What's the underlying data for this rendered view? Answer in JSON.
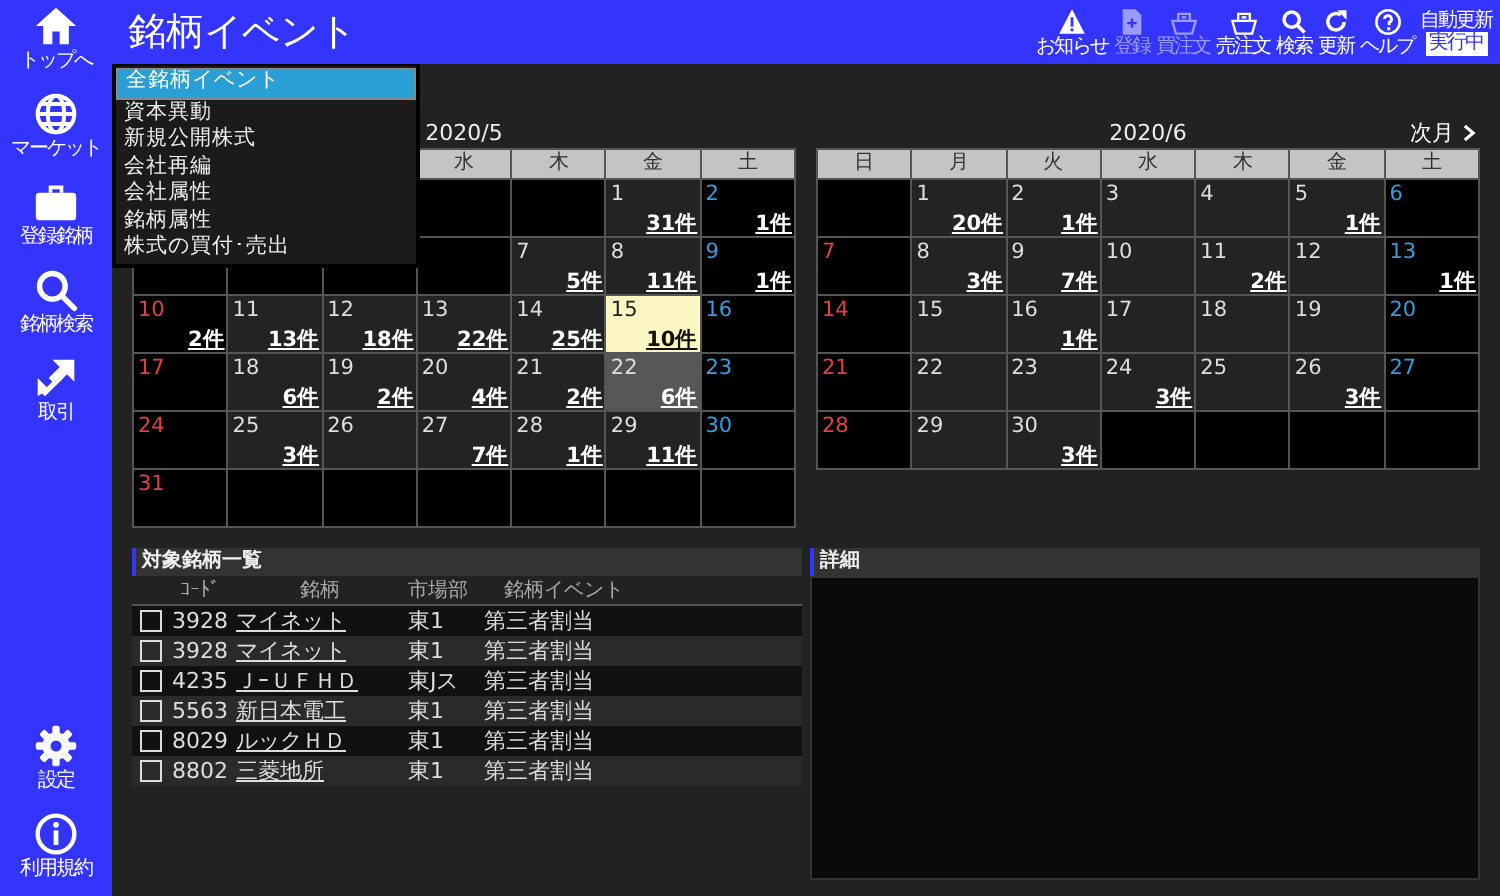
{
  "sidebar": {
    "top_items": [
      {
        "label": "トップへ"
      },
      {
        "label": "マーケット"
      },
      {
        "label": "登録銘柄"
      },
      {
        "label": "銘柄検索"
      },
      {
        "label": "取引"
      }
    ],
    "bottom_items": [
      {
        "label": "設定"
      },
      {
        "label": "利用規約"
      }
    ]
  },
  "header": {
    "title": "銘柄イベント",
    "toolbar": [
      {
        "label": "お知らせ",
        "disabled": false
      },
      {
        "label": "登録",
        "disabled": true
      },
      {
        "label": "買注文",
        "disabled": true
      },
      {
        "label": "売注文",
        "disabled": false
      },
      {
        "label": "検索",
        "disabled": false
      },
      {
        "label": "更新",
        "disabled": false
      },
      {
        "label": "ヘルプ",
        "disabled": false
      }
    ],
    "auto_update": {
      "label": "自動更新",
      "status": "実行中"
    }
  },
  "event_menu": [
    {
      "label": "全銘柄イベント",
      "selected": true
    },
    {
      "label": "資本異動",
      "selected": false
    },
    {
      "label": "新規公開株式",
      "selected": false
    },
    {
      "label": "会社再編",
      "selected": false
    },
    {
      "label": "会社属性",
      "selected": false
    },
    {
      "label": "銘柄属性",
      "selected": false
    },
    {
      "label": "株式の買付･売出",
      "selected": false
    }
  ],
  "calendars": [
    {
      "title": "2020/5",
      "weekdays": [
        {
          "label": "水"
        },
        {
          "label": "木"
        },
        {
          "label": "金"
        },
        {
          "label": "土"
        }
      ],
      "weeks": [
        [
          {
            "kind": "empty"
          },
          {
            "kind": "empty"
          },
          {
            "kind": "weekday",
            "day": "1",
            "count": "31件"
          },
          {
            "kind": "saturday",
            "day": "2",
            "count": "1件"
          }
        ],
        [
          {
            "kind": "sunday"
          },
          {
            "kind": "holiday"
          },
          {
            "kind": "holiday"
          },
          {
            "kind": "holiday"
          },
          {
            "kind": "weekday",
            "day": "7",
            "count": "5件"
          },
          {
            "kind": "weekday",
            "day": "8",
            "count": "11件"
          },
          {
            "kind": "saturday",
            "day": "9",
            "count": "1件"
          }
        ],
        [
          {
            "kind": "sunday",
            "day": "10",
            "count": "2件"
          },
          {
            "kind": "weekday",
            "day": "11",
            "count": "13件"
          },
          {
            "kind": "weekday",
            "day": "12",
            "count": "18件"
          },
          {
            "kind": "weekday",
            "day": "13",
            "count": "22件"
          },
          {
            "kind": "weekday",
            "day": "14",
            "count": "25件"
          },
          {
            "kind": "today",
            "day": "15",
            "count": "10件"
          },
          {
            "kind": "saturday",
            "day": "16"
          }
        ],
        [
          {
            "kind": "sunday",
            "day": "17"
          },
          {
            "kind": "weekday",
            "day": "18",
            "count": "6件"
          },
          {
            "kind": "weekday",
            "day": "19",
            "count": "2件"
          },
          {
            "kind": "weekday",
            "day": "20",
            "count": "4件"
          },
          {
            "kind": "weekday",
            "day": "21",
            "count": "2件"
          },
          {
            "kind": "selected",
            "day": "22",
            "count": "6件"
          },
          {
            "kind": "saturday",
            "day": "23"
          }
        ],
        [
          {
            "kind": "sunday",
            "day": "24"
          },
          {
            "kind": "weekday",
            "day": "25",
            "count": "3件"
          },
          {
            "kind": "weekday",
            "day": "26"
          },
          {
            "kind": "weekday",
            "day": "27",
            "count": "7件"
          },
          {
            "kind": "weekday",
            "day": "28",
            "count": "1件"
          },
          {
            "kind": "weekday",
            "day": "29",
            "count": "11件"
          },
          {
            "kind": "saturday",
            "day": "30"
          }
        ],
        [
          {
            "kind": "sunday",
            "day": "31"
          },
          {
            "kind": "empty"
          },
          {
            "kind": "empty"
          },
          {
            "kind": "empty"
          },
          {
            "kind": "empty"
          },
          {
            "kind": "empty"
          },
          {
            "kind": "empty"
          }
        ]
      ]
    },
    {
      "title": "2020/6",
      "next": "次月",
      "weekdays": [
        {
          "label": "日"
        },
        {
          "label": "月"
        },
        {
          "label": "火"
        },
        {
          "label": "水"
        },
        {
          "label": "木"
        },
        {
          "label": "金"
        },
        {
          "label": "土"
        }
      ],
      "weeks": [
        [
          {
            "kind": "empty"
          },
          {
            "kind": "weekday",
            "day": "1",
            "count": "20件"
          },
          {
            "kind": "weekday",
            "day": "2",
            "count": "1件"
          },
          {
            "kind": "weekday",
            "day": "3"
          },
          {
            "kind": "weekday",
            "day": "4"
          },
          {
            "kind": "weekday",
            "day": "5",
            "count": "1件"
          },
          {
            "kind": "saturday",
            "day": "6"
          }
        ],
        [
          {
            "kind": "sunday",
            "day": "7"
          },
          {
            "kind": "weekday",
            "day": "8",
            "count": "3件"
          },
          {
            "kind": "weekday",
            "day": "9",
            "count": "7件"
          },
          {
            "kind": "weekday",
            "day": "10"
          },
          {
            "kind": "weekday",
            "day": "11",
            "count": "2件"
          },
          {
            "kind": "weekday",
            "day": "12"
          },
          {
            "kind": "saturday",
            "day": "13",
            "count": "1件"
          }
        ],
        [
          {
            "kind": "sunday",
            "day": "14"
          },
          {
            "kind": "weekday",
            "day": "15"
          },
          {
            "kind": "weekday",
            "day": "16",
            "count": "1件"
          },
          {
            "kind": "weekday",
            "day": "17"
          },
          {
            "kind": "weekday",
            "day": "18"
          },
          {
            "kind": "weekday",
            "day": "19"
          },
          {
            "kind": "saturday",
            "day": "20"
          }
        ],
        [
          {
            "kind": "sunday",
            "day": "21"
          },
          {
            "kind": "weekday",
            "day": "22"
          },
          {
            "kind": "weekday",
            "day": "23"
          },
          {
            "kind": "weekday",
            "day": "24",
            "count": "3件"
          },
          {
            "kind": "weekday",
            "day": "25"
          },
          {
            "kind": "weekday",
            "day": "26",
            "count": "3件"
          },
          {
            "kind": "saturday",
            "day": "27"
          }
        ],
        [
          {
            "kind": "sunday",
            "day": "28"
          },
          {
            "kind": "weekday",
            "day": "29"
          },
          {
            "kind": "weekday",
            "day": "30",
            "count": "3件"
          },
          {
            "kind": "empty"
          },
          {
            "kind": "empty"
          },
          {
            "kind": "empty"
          },
          {
            "kind": "empty"
          }
        ]
      ]
    }
  ],
  "stock_list": {
    "title": "対象銘柄一覧",
    "columns": [
      "ｺｰﾄﾞ",
      "銘柄",
      "市場部",
      "銘柄イベント"
    ],
    "rows": [
      {
        "checked": false,
        "code": "3928",
        "name": "マイネット",
        "market": "東1",
        "event": "第三者割当"
      },
      {
        "checked": false,
        "code": "3928",
        "name": "マイネット",
        "market": "東1",
        "event": "第三者割当"
      },
      {
        "checked": false,
        "code": "4235",
        "name": "ＪｰＵＦＨＤ",
        "market": "東Jス",
        "event": "第三者割当"
      },
      {
        "checked": false,
        "code": "5563",
        "name": "新日本電工",
        "market": "東1",
        "event": "第三者割当"
      },
      {
        "checked": false,
        "code": "8029",
        "name": "ルックＨＤ",
        "market": "東1",
        "event": "第三者割当"
      },
      {
        "checked": false,
        "code": "8802",
        "name": "三菱地所",
        "market": "東1",
        "event": "第三者割当"
      }
    ]
  },
  "detail": {
    "title": "詳細"
  }
}
